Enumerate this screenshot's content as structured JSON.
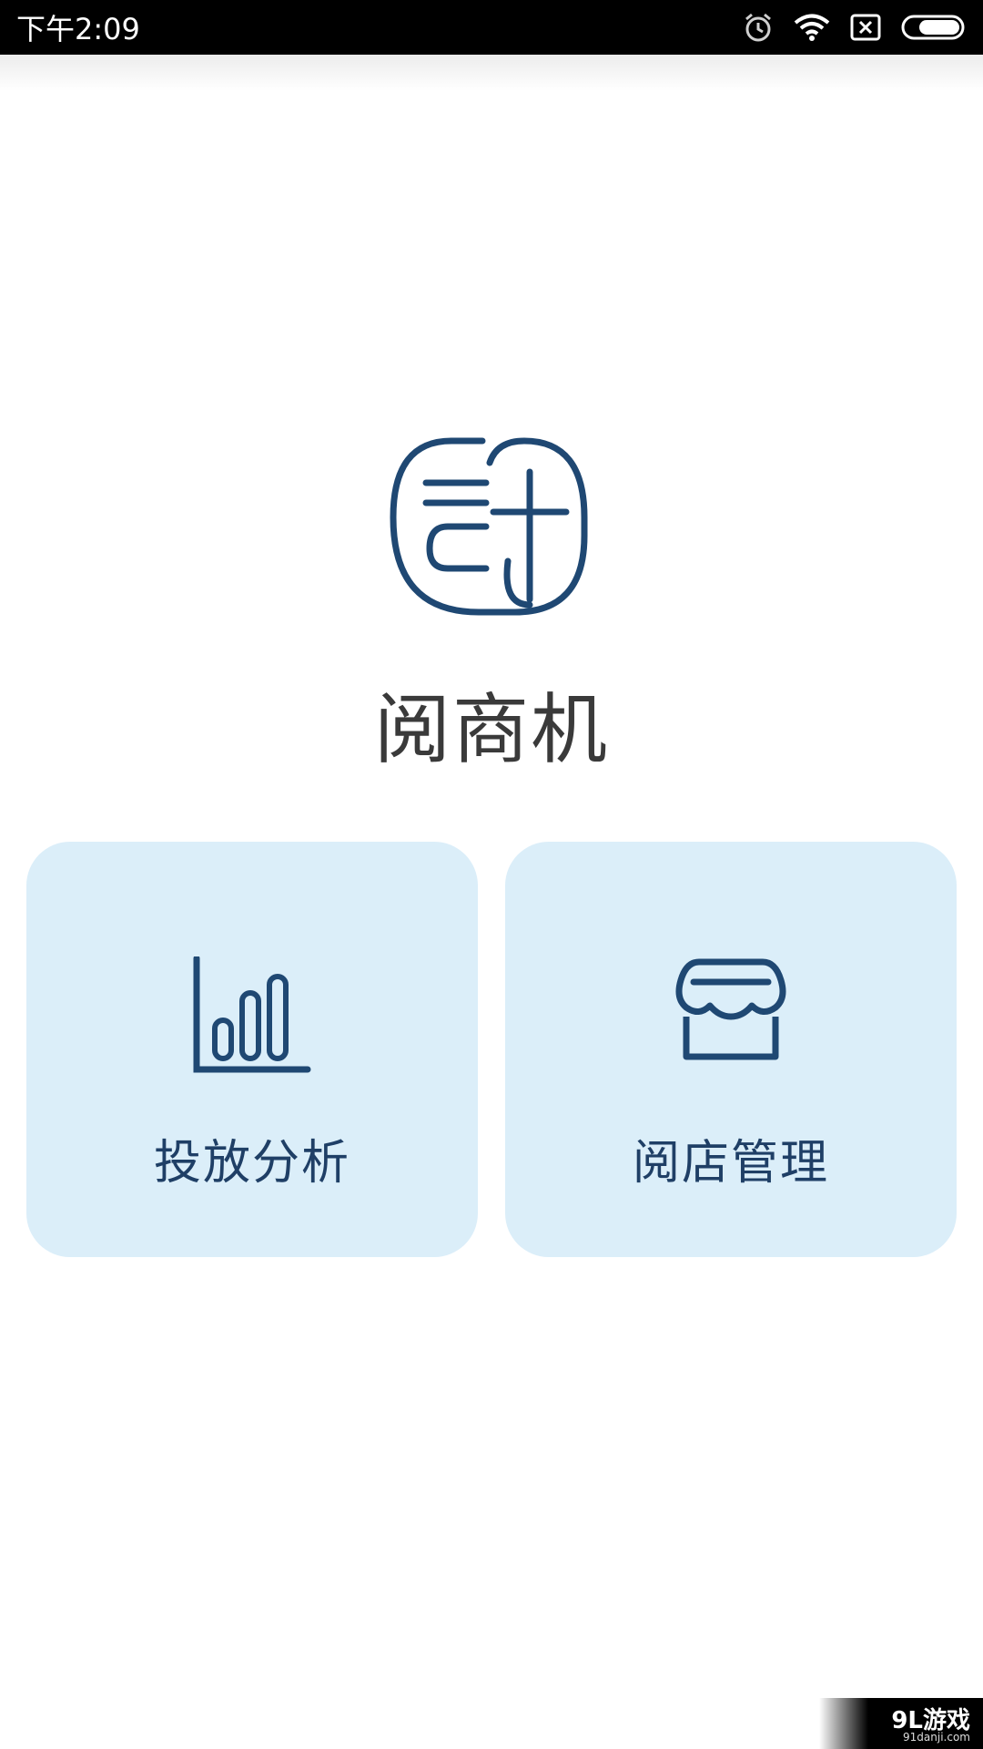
{
  "status_bar": {
    "time": "下午2:09",
    "icons": [
      "alarm-icon",
      "wifi-icon",
      "no-sim-icon",
      "battery-icon"
    ]
  },
  "app": {
    "name": "阅商机"
  },
  "cards": [
    {
      "label": "投放分析",
      "icon": "bar-chart-icon"
    },
    {
      "label": "阅店管理",
      "icon": "storefront-icon"
    }
  ],
  "watermark": {
    "main": "9L游戏",
    "sub": "91danji.com"
  },
  "colors": {
    "brand": "#1f4873",
    "card_bg": "#dbeef9",
    "card_text": "#1f3f66",
    "status_bar_bg": "#000000"
  }
}
